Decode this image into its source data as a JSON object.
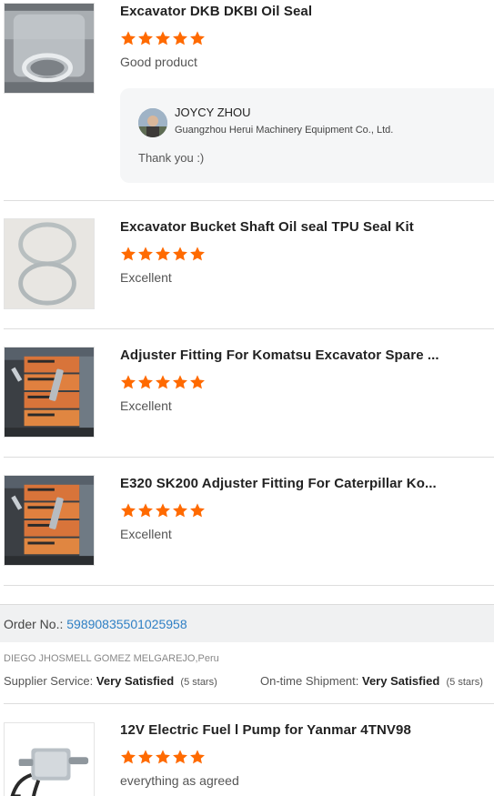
{
  "star_color": "#ff6a00",
  "products": [
    {
      "title": "Excavator DKB DKBI Oil Seal",
      "rating": 5,
      "review": "Good product",
      "image": "oil-seal-photo",
      "reply": {
        "name": "JOYCY ZHOU",
        "company": "Guangzhou Herui Machinery Equipment Co., Ltd.",
        "text": "Thank you :)"
      }
    },
    {
      "title": "Excavator Bucket Shaft Oil seal TPU Seal Kit",
      "rating": 5,
      "review": "Excellent",
      "image": "seal-rings-photo"
    },
    {
      "title": "Adjuster Fitting For Komatsu Excavator Spare ...",
      "rating": 5,
      "review": "Excellent",
      "image": "adjuster-boxes-photo"
    },
    {
      "title": "E320 SK200 Adjuster Fitting For Caterpillar Ko...",
      "rating": 5,
      "review": "Excellent",
      "image": "adjuster-boxes-photo"
    }
  ],
  "order": {
    "label": "Order No.:",
    "number": "59890835501025958",
    "buyer": "DIEGO JHOSMELL GOMEZ MELGAREJO,Peru",
    "supplier_service_label": "Supplier Service:",
    "supplier_service_value": "Very Satisfied",
    "supplier_service_stars": "(5 stars)",
    "shipment_label": "On-time Shipment:",
    "shipment_value": "Very Satisfied",
    "shipment_stars": "(5 stars)"
  },
  "order_product": {
    "title": "12V Electric Fuel l Pump for Yanmar 4TNV98",
    "rating": 5,
    "review": "everything as agreed",
    "image": "fuel-pump-photo"
  }
}
